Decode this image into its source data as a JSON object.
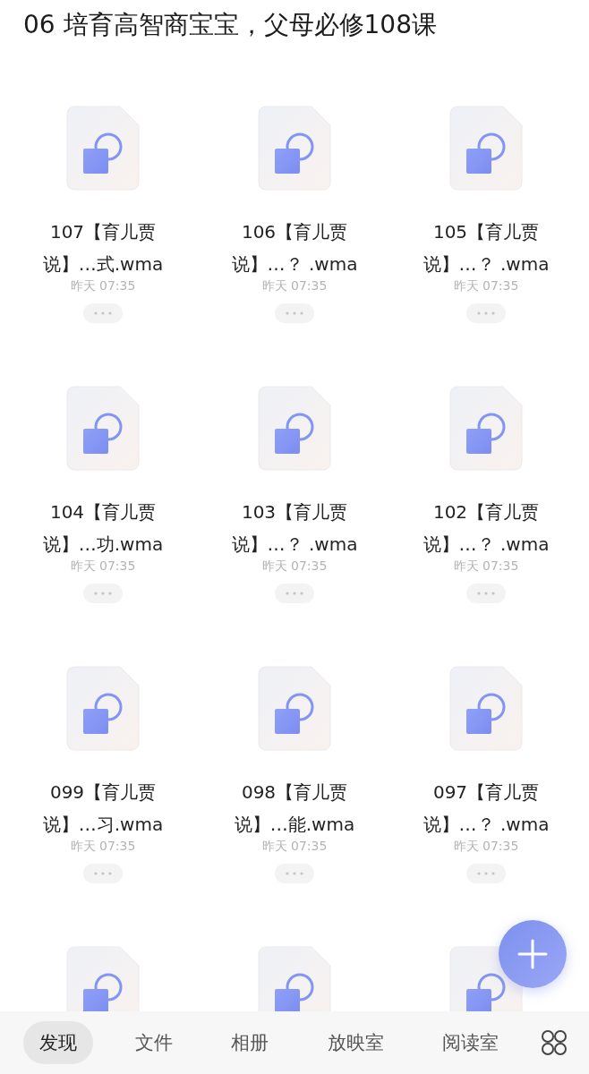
{
  "title": "06 培育高智商宝宝，父母必修108课",
  "files": [
    {
      "kind": "file",
      "name": "107【育儿贾说】…式.wma",
      "time": "昨天 07:35"
    },
    {
      "kind": "file",
      "name": "106【育儿贾说】…？ .wma",
      "time": "昨天 07:35"
    },
    {
      "kind": "file",
      "name": "105【育儿贾说】…？ .wma",
      "time": "昨天 07:35"
    },
    {
      "kind": "file",
      "name": "104【育儿贾说】…功.wma",
      "time": "昨天 07:35"
    },
    {
      "kind": "file",
      "name": "103【育儿贾说】…？ .wma",
      "time": "昨天 07:35"
    },
    {
      "kind": "file",
      "name": "102【育儿贾说】…？ .wma",
      "time": "昨天 07:35"
    },
    {
      "kind": "file",
      "name": "099【育儿贾说】…习.wma",
      "time": "昨天 07:35"
    },
    {
      "kind": "file",
      "name": "098【育儿贾说】…能.wma",
      "time": "昨天 07:35"
    },
    {
      "kind": "file",
      "name": "097【育儿贾说】…？ .wma",
      "time": "昨天 07:35"
    },
    {
      "kind": "file"
    },
    {
      "kind": "file"
    },
    {
      "kind": "file"
    }
  ],
  "tabs": [
    {
      "label": "发现",
      "selected": true
    },
    {
      "label": "文件",
      "selected": false
    },
    {
      "label": "相册",
      "selected": false
    },
    {
      "label": "放映室",
      "selected": false
    },
    {
      "label": "阅读室",
      "selected": false
    }
  ]
}
